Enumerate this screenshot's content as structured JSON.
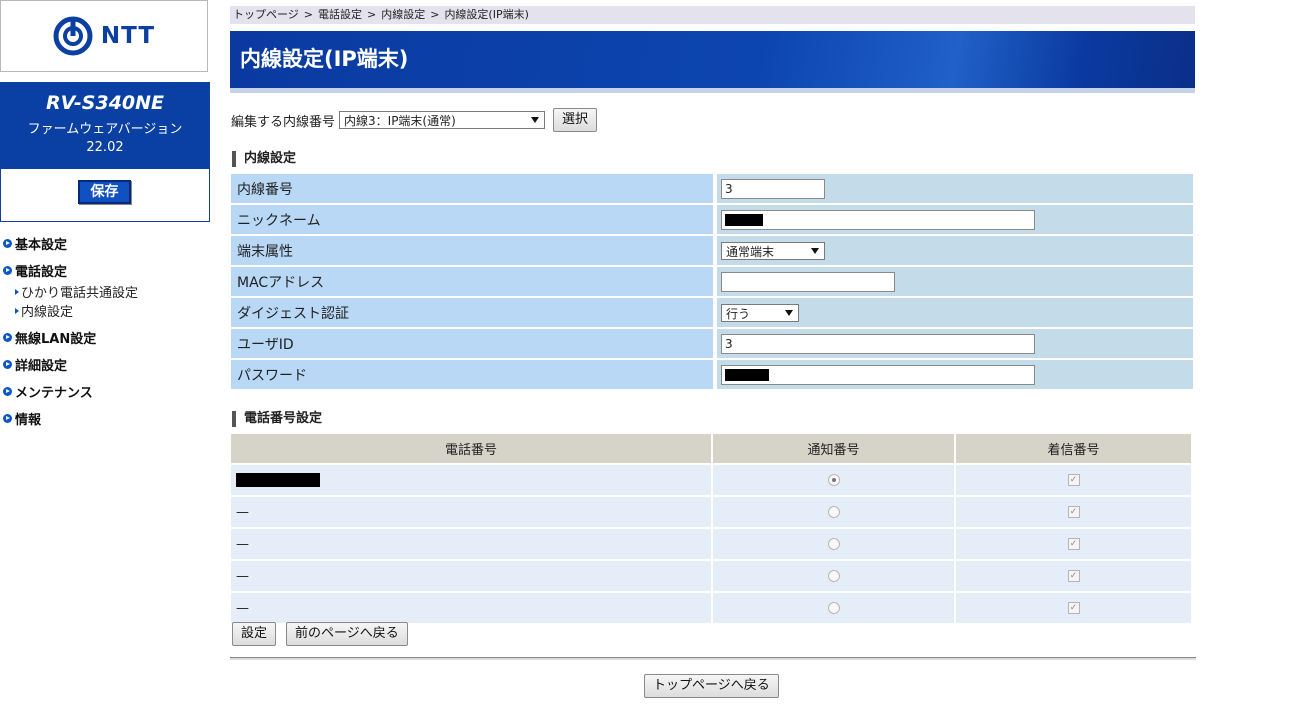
{
  "brand": {
    "logo_text": "NTT",
    "logo_color": "#0b3fa0"
  },
  "device": {
    "model": "RV-S340NE",
    "firmware_label": "ファームウェアバージョン",
    "firmware_version": "22.02",
    "save_label": "保存"
  },
  "nav": {
    "basic": "基本設定",
    "phone": "電話設定",
    "phone_sub_hikari": "ひかり電話共通設定",
    "phone_sub_extension": "内線設定",
    "wlan": "無線LAN設定",
    "advanced": "詳細設定",
    "maintenance": "メンテナンス",
    "info": "情報"
  },
  "breadcrumb": [
    "トップページ",
    "電話設定",
    "内線設定",
    "内線設定(IP端末)"
  ],
  "breadcrumb_sep": ">",
  "page_title": "内線設定(IP端末)",
  "editor": {
    "label": "編集する内線番号",
    "selected": "内線3：IP端末(通常)",
    "select_button": "選択"
  },
  "extension_section": {
    "title": "内線設定",
    "fields": {
      "ext_number": {
        "label": "内線番号",
        "value": "3"
      },
      "nickname": {
        "label": "ニックネーム"
      },
      "terminal_type": {
        "label": "端末属性",
        "selected": "通常端末"
      },
      "mac_address": {
        "label": "MACアドレス",
        "value": ""
      },
      "digest_auth": {
        "label": "ダイジェスト認証",
        "selected": "行う"
      },
      "user_id": {
        "label": "ユーザID",
        "value": "3"
      },
      "password": {
        "label": "パスワード"
      }
    }
  },
  "phone_section": {
    "title": "電話番号設定",
    "columns": [
      "電話番号",
      "通知番号",
      "着信番号"
    ],
    "rows": [
      {
        "number": "",
        "notify": "selected",
        "incoming": "checked"
      },
      {
        "number": "—",
        "notify": "disabled",
        "incoming": "checked"
      },
      {
        "number": "—",
        "notify": "disabled",
        "incoming": "checked"
      },
      {
        "number": "—",
        "notify": "disabled",
        "incoming": "checked"
      },
      {
        "number": "—",
        "notify": "disabled",
        "incoming": "checked"
      }
    ]
  },
  "actions": {
    "set": "設定",
    "back": "前のページへ戻る",
    "top": "トップページへ戻る"
  },
  "colors": {
    "banner": "#0a3aa0",
    "label_cell": "#b8d8f6",
    "value_cell": "#c4dcea",
    "table_header": "#d6d3c8",
    "table_row": "#e4edf8"
  }
}
